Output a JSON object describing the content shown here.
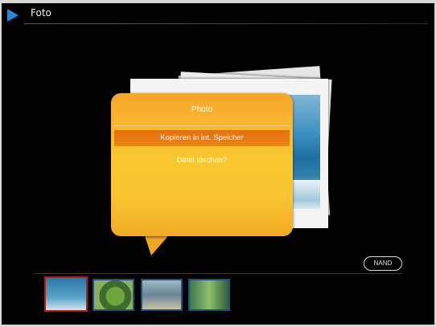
{
  "header": {
    "title": "Foto",
    "icon": "play-arrow-icon",
    "accent_color": "#1e88e5"
  },
  "dialog": {
    "title": "Photo",
    "selected_item": "Kopieren in int. Speicher",
    "item": "Datei löschen?",
    "bg_color": "#f9c631",
    "highlight_color": "#e8760f"
  },
  "storage_badge": "NAND",
  "thumbnails": [
    {
      "name": "whale",
      "selected": true
    },
    {
      "name": "frog",
      "selected": false
    },
    {
      "name": "people",
      "selected": false
    },
    {
      "name": "child",
      "selected": false
    }
  ]
}
